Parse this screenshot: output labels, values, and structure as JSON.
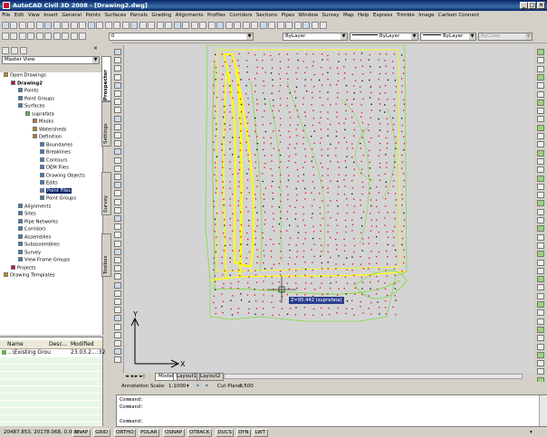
{
  "window": {
    "title": "AutoCAD Civil 3D 2008 - [Drawing2.dwg]"
  },
  "menu": [
    "File",
    "Edit",
    "View",
    "Insert",
    "General",
    "Points",
    "Surfaces",
    "Parcels",
    "Grading",
    "Alignments",
    "Profiles",
    "Corridors",
    "Sections",
    "Pipes",
    "Window",
    "Survey",
    "Map",
    "Help",
    "Express",
    "Trimble",
    "Image",
    "Carlson Connect"
  ],
  "toolbar": {
    "layer_value": "0",
    "color_value": "ByLayer",
    "linetype_value": "ByLayer",
    "lineweight_value": "ByLayer",
    "plotstyle_value": "ByColor"
  },
  "prospector": {
    "view_select": "Master View",
    "tree": [
      {
        "label": "Open Drawings",
        "level": 0,
        "bold": false
      },
      {
        "label": "Drawing2",
        "level": 1,
        "bold": true
      },
      {
        "label": "Points",
        "level": 2
      },
      {
        "label": "Point Groups",
        "level": 2
      },
      {
        "label": "Surfaces",
        "level": 2
      },
      {
        "label": "suprafata",
        "level": 3
      },
      {
        "label": "Masks",
        "level": 4
      },
      {
        "label": "Watersheds",
        "level": 4
      },
      {
        "label": "Definition",
        "level": 4
      },
      {
        "label": "Boundaries",
        "level": 5
      },
      {
        "label": "Breaklines",
        "level": 5
      },
      {
        "label": "Contours",
        "level": 5
      },
      {
        "label": "DEM Files",
        "level": 5
      },
      {
        "label": "Drawing Objects",
        "level": 5
      },
      {
        "label": "Edits",
        "level": 5
      },
      {
        "label": "Point Files",
        "level": 5,
        "selected": true
      },
      {
        "label": "Point Groups",
        "level": 5
      },
      {
        "label": "Alignments",
        "level": 2
      },
      {
        "label": "Sites",
        "level": 2
      },
      {
        "label": "Pipe Networks",
        "level": 2
      },
      {
        "label": "Corridors",
        "level": 2
      },
      {
        "label": "Assemblies",
        "level": 2
      },
      {
        "label": "Subassemblies",
        "level": 2
      },
      {
        "label": "Survey",
        "level": 2
      },
      {
        "label": "View Frame Groups",
        "level": 2
      },
      {
        "label": "Projects",
        "level": 1
      },
      {
        "label": "Drawing Templates",
        "level": 0
      }
    ],
    "side_tabs": [
      "Prospector",
      "Settings",
      "Survey",
      "Toolbox"
    ],
    "grid": {
      "columns": [
        "Name",
        "Desc...",
        "Modified"
      ],
      "rows": [
        {
          "name": "...\\Existing Grou",
          "desc": "",
          "modified": "23.03.2...:32"
        }
      ]
    }
  },
  "drawing": {
    "tooltip": "Z=95.442 (suprafata)",
    "ucs_x": "X",
    "ucs_y": "Y",
    "tabs": [
      "Model",
      "Layout1",
      "Layout2"
    ],
    "annotation_scale_label": "Annotation Scale:",
    "annotation_scale_value": "1:1000",
    "cut_plane_label": "Cut Plane:",
    "cut_plane_value": "3.500"
  },
  "command_lines": [
    "Command:",
    "Command:",
    "",
    "Command:"
  ],
  "status": {
    "coords": "20487.853, 20178.068, 0.000",
    "toggles": [
      "SNAP",
      "GRID",
      "ORTHO",
      "POLAR",
      "OSNAP",
      "OTRACK",
      "DUCS",
      "DYN",
      "LWT"
    ]
  },
  "colors": {
    "contour_yellow": "#ffff00",
    "contour_green": "#7ddc3a",
    "points_red": "#e8001a",
    "canvas": "#d4d4d4"
  }
}
